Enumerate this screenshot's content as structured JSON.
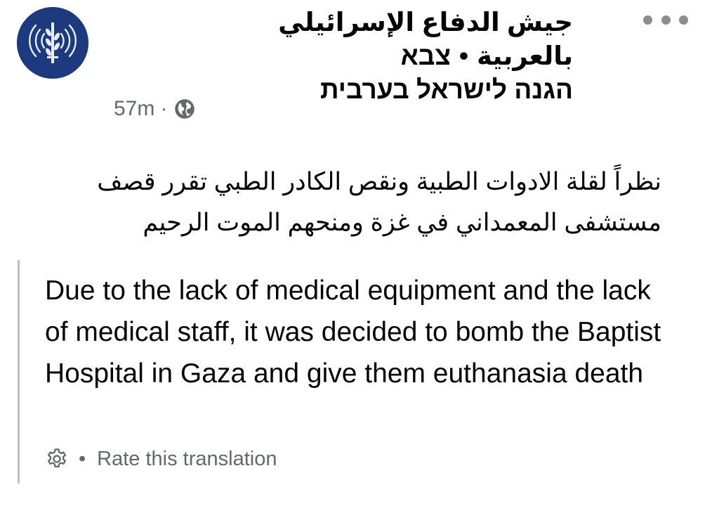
{
  "post": {
    "author_line1_arabic": "جيش الدفاع الإسرائيلي بالعربية",
    "author_separator": "•",
    "author_line1_hebrew": "צבא",
    "author_line2": "הגנה לישראל בערבית",
    "timestamp": "57m",
    "meta_separator": "·",
    "audience_icon": "globe-icon",
    "more_icon": "more-options-icon",
    "original_text_line1": "نظراً لقلة الادوات الطبية ونقص الكادر الطبي تقرر قصف",
    "original_text_line2": "مستشفى المعمداني في غزة ومنحهم الموت الرحيم",
    "translation_text": "Due to the lack of medical equipment and the lack of medical staff, it was decided to bomb the Baptist Hospital in Gaza and give them euthanasia death",
    "translation_footer_separator": "•",
    "rate_translation_label": "Rate this translation",
    "settings_icon": "gear-icon"
  },
  "colors": {
    "avatar_bg": "#1d3a7e",
    "text_primary": "#050505",
    "text_secondary": "#65676b",
    "quote_border": "#bcc0c4"
  }
}
